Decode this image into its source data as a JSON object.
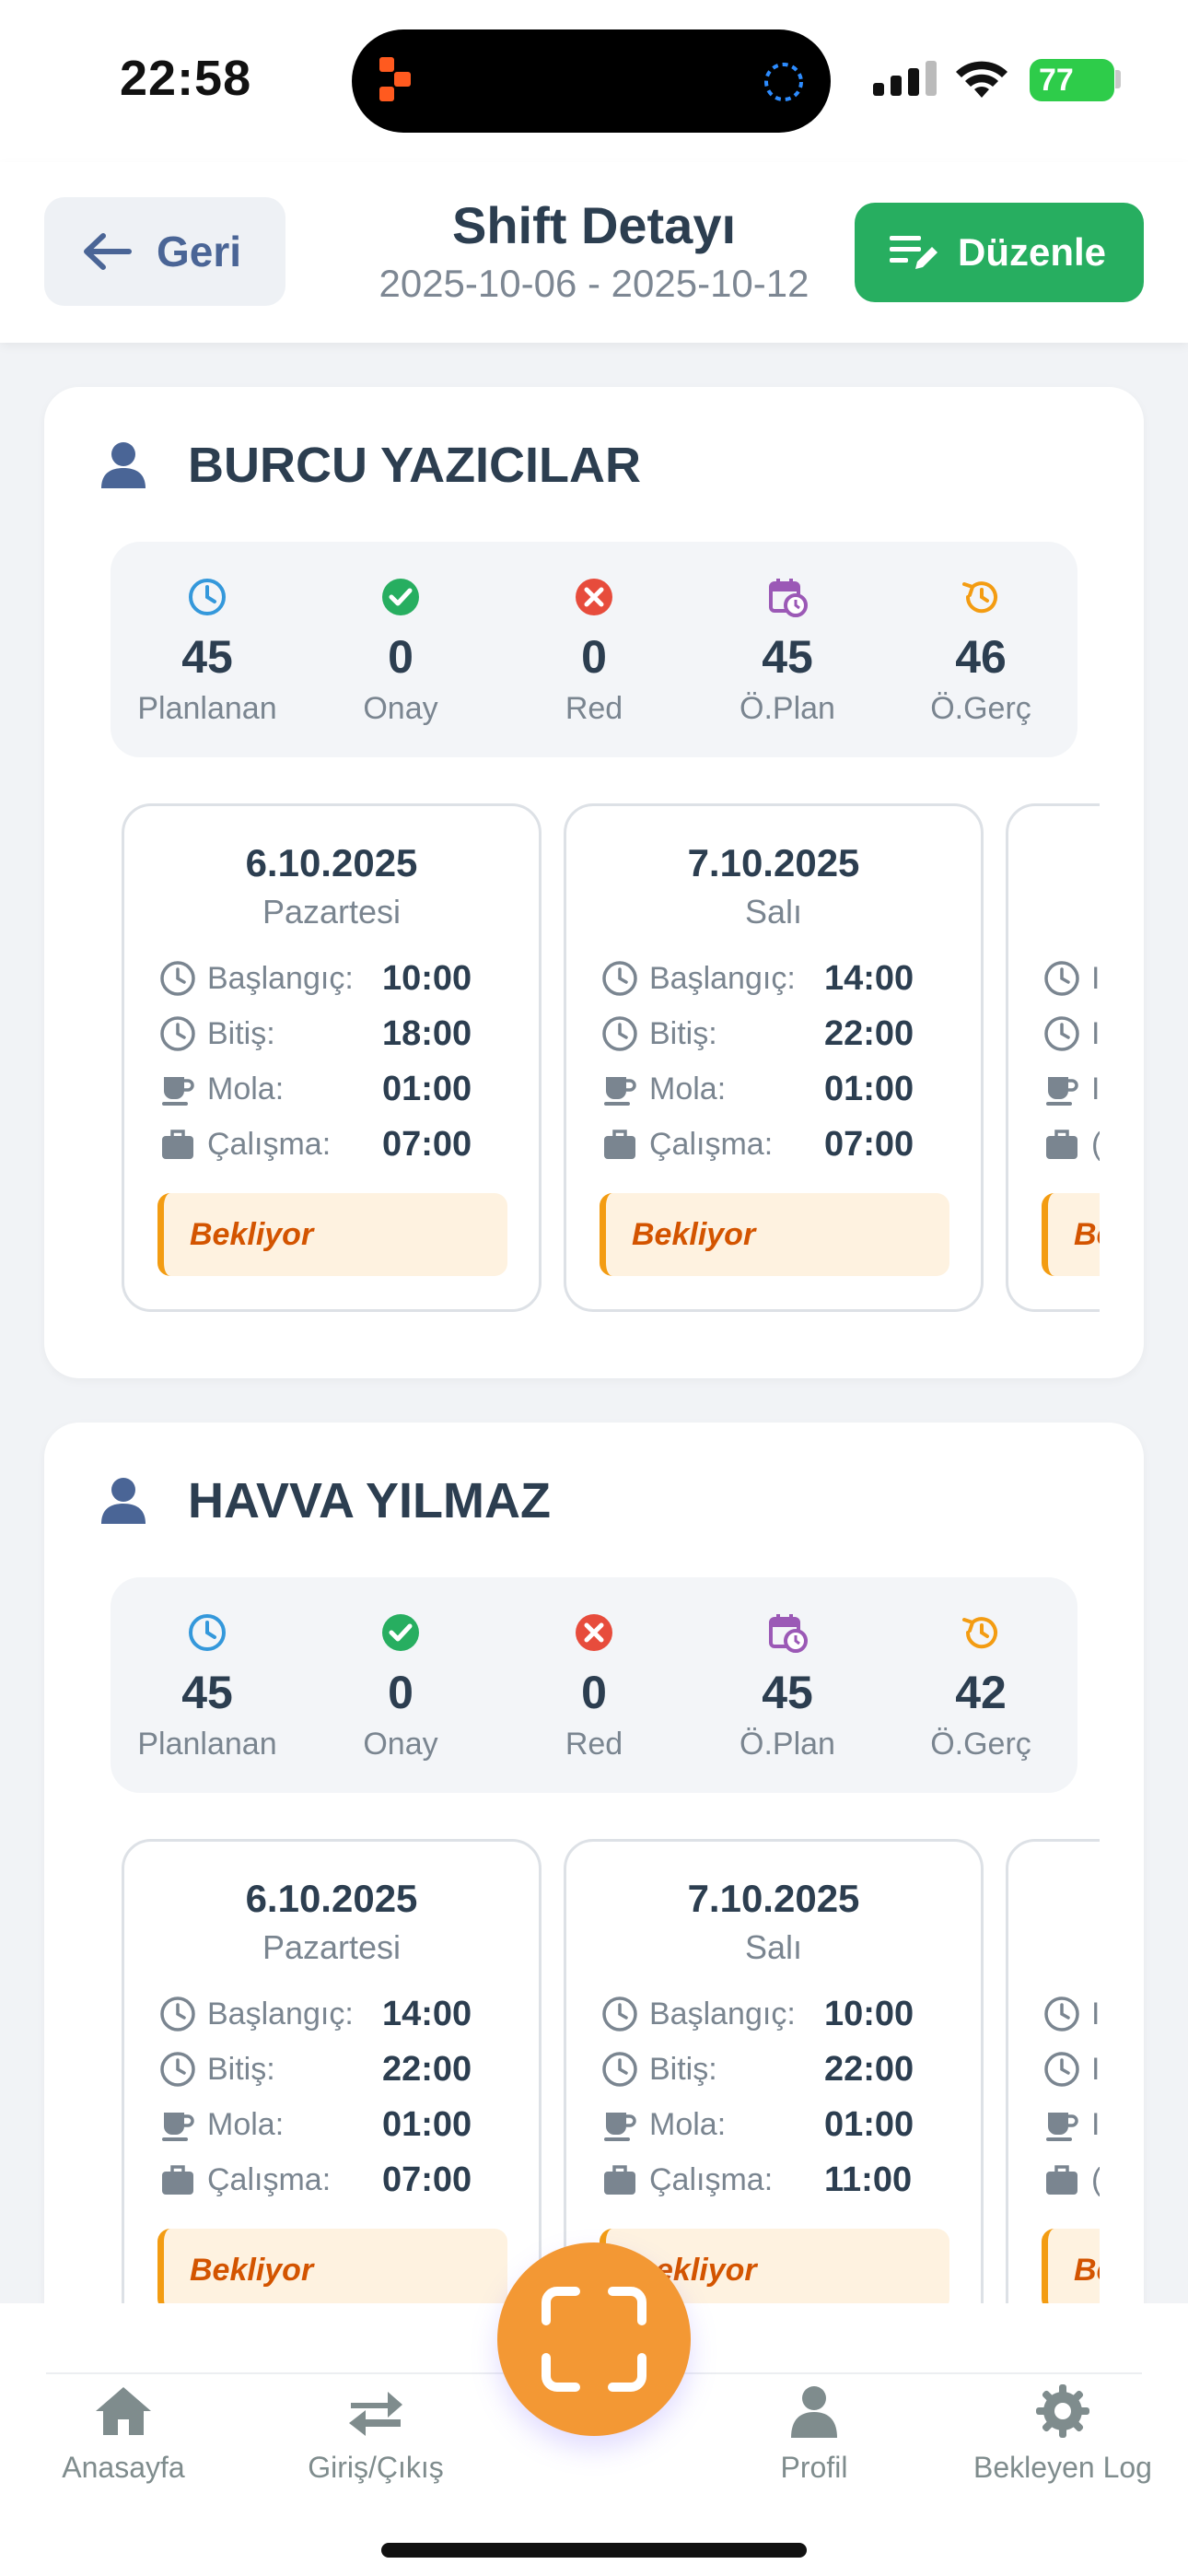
{
  "status_bar": {
    "time": "22:58",
    "battery": "77"
  },
  "header": {
    "back_label": "Geri",
    "title": "Shift Detayı",
    "date_range": "2025-10-06 - 2025-10-12",
    "edit_label": "Düzenle"
  },
  "employees": [
    {
      "name": "BURCU YAZICILAR",
      "stats": [
        {
          "value": "45",
          "label": "Planlanan",
          "icon": "clock-icon"
        },
        {
          "value": "0",
          "label": "Onay",
          "icon": "check-circle-icon"
        },
        {
          "value": "0",
          "label": "Red",
          "icon": "x-circle-icon"
        },
        {
          "value": "45",
          "label": "Ö.Plan",
          "icon": "calendar-clock-icon"
        },
        {
          "value": "46",
          "label": "Ö.Gerç",
          "icon": "history-icon"
        }
      ],
      "days": [
        {
          "date": "6.10.2025",
          "weekday": "Pazartesi",
          "start_label": "Başlangıç:",
          "start": "10:00",
          "end_label": "Bitiş:",
          "end": "18:00",
          "break_label": "Mola:",
          "break": "01:00",
          "work_label": "Çalışma:",
          "work": "07:00",
          "status": "Bekliyor"
        },
        {
          "date": "7.10.2025",
          "weekday": "Salı",
          "start_label": "Başlangıç:",
          "start": "14:00",
          "end_label": "Bitiş:",
          "end": "22:00",
          "break_label": "Mola:",
          "break": "01:00",
          "work_label": "Çalışma:",
          "work": "07:00",
          "status": "Bekliyor"
        },
        {
          "date": "",
          "weekday": "",
          "start_label": "I",
          "start": "",
          "end_label": "I",
          "end": "",
          "break_label": "I",
          "break": "",
          "work_label": "(",
          "work": "",
          "status": "Be"
        }
      ]
    },
    {
      "name": "HAVVA YILMAZ",
      "stats": [
        {
          "value": "45",
          "label": "Planlanan",
          "icon": "clock-icon"
        },
        {
          "value": "0",
          "label": "Onay",
          "icon": "check-circle-icon"
        },
        {
          "value": "0",
          "label": "Red",
          "icon": "x-circle-icon"
        },
        {
          "value": "45",
          "label": "Ö.Plan",
          "icon": "calendar-clock-icon"
        },
        {
          "value": "42",
          "label": "Ö.Gerç",
          "icon": "history-icon"
        }
      ],
      "days": [
        {
          "date": "6.10.2025",
          "weekday": "Pazartesi",
          "start_label": "Başlangıç:",
          "start": "14:00",
          "end_label": "Bitiş:",
          "end": "22:00",
          "break_label": "Mola:",
          "break": "01:00",
          "work_label": "Çalışma:",
          "work": "07:00",
          "status": "Bekliyor"
        },
        {
          "date": "7.10.2025",
          "weekday": "Salı",
          "start_label": "Başlangıç:",
          "start": "10:00",
          "end_label": "Bitiş:",
          "end": "22:00",
          "break_label": "Mola:",
          "break": "01:00",
          "work_label": "Çalışma:",
          "work": "11:00",
          "status": "ekliyor"
        },
        {
          "date": "",
          "weekday": "",
          "start_label": "I",
          "start": "",
          "end_label": "I",
          "end": "",
          "break_label": "I",
          "break": "",
          "work_label": "(",
          "work": "",
          "status": "Be"
        }
      ]
    }
  ],
  "nav": {
    "home": "Anasayfa",
    "checkinout": "Giriş/Çıkış",
    "profile": "Profil",
    "pending_log": "Bekleyen Log"
  },
  "colors": {
    "primary": "#4a6596",
    "success": "#27ae60",
    "danger": "#e74c3c",
    "purple": "#9b59b6",
    "orange": "#f39c12",
    "scan": "#f39834",
    "info": "#3498db"
  }
}
